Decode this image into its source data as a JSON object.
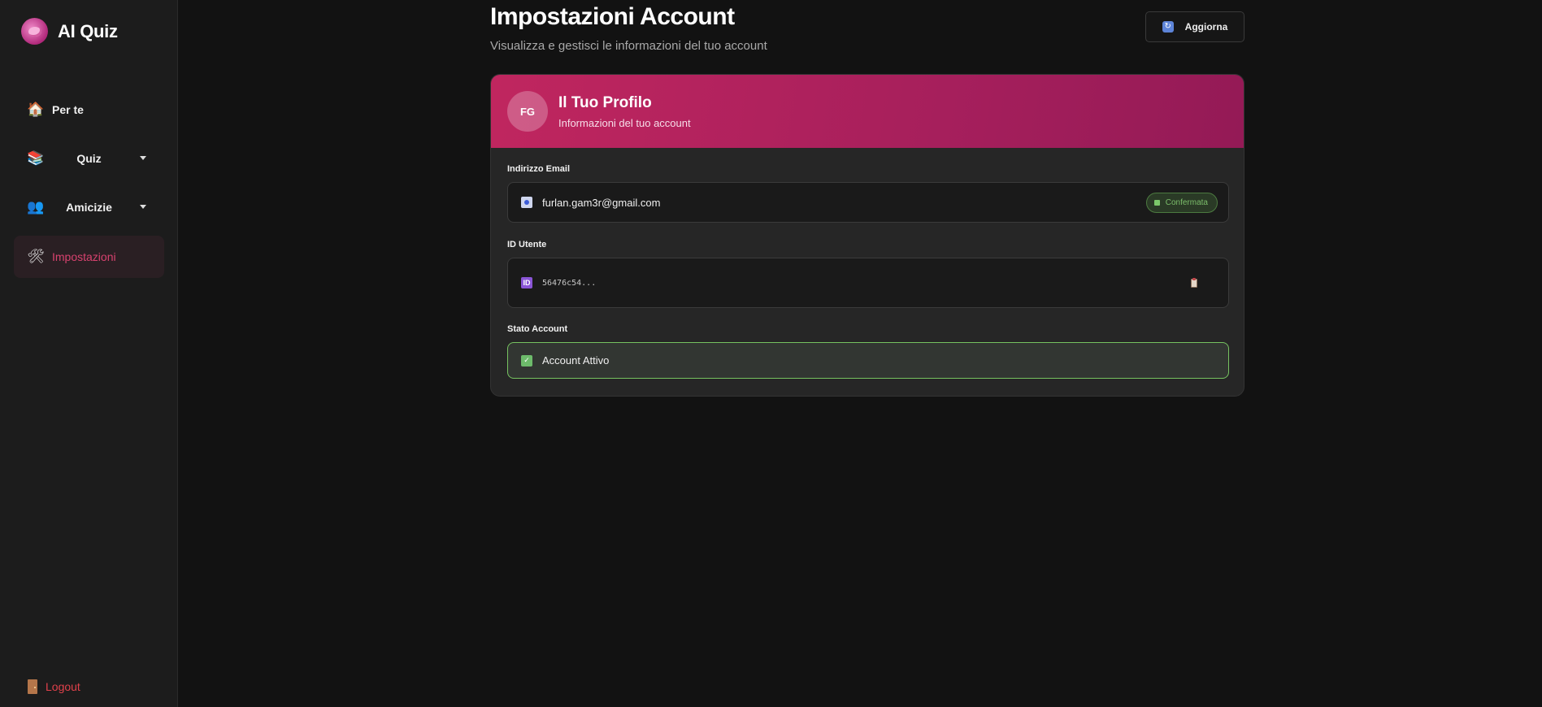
{
  "app": {
    "title": "AI Quiz"
  },
  "sidebar": {
    "items": [
      {
        "label": "Per te",
        "icon": "house-icon"
      },
      {
        "label": "Quiz",
        "icon": "books-icon"
      },
      {
        "label": "Amicizie",
        "icon": "people-icon"
      },
      {
        "label": "Impostazioni",
        "icon": "tools-icon"
      }
    ],
    "logout_label": "Logout"
  },
  "header": {
    "title": "Impostazioni Account",
    "subtitle": "Visualizza e gestisci le informazioni del tuo account",
    "refresh_label": "Aggiorna"
  },
  "profile": {
    "initials": "FG",
    "title": "Il Tuo Profilo",
    "subtitle": "Informazioni del tuo account",
    "email_label": "Indirizzo Email",
    "email": "furlan.gam3r@gmail.com",
    "email_status": "Confermata",
    "user_id_label": "ID Utente",
    "user_id": "56476c54...",
    "status_label": "Stato Account",
    "status": "Account Attivo"
  },
  "colors": {
    "accent": "#c0265f",
    "active_nav": "#d8426f",
    "success": "#76c360",
    "danger": "#e0414b"
  }
}
